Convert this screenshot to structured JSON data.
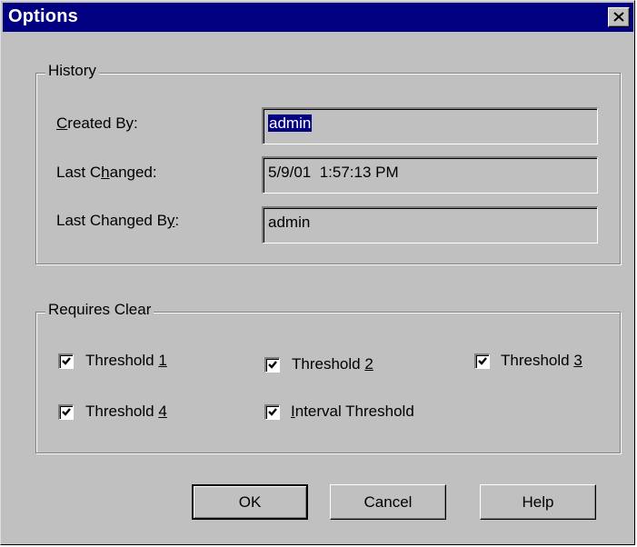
{
  "dialog": {
    "title": "Options",
    "close_glyph": "close-icon"
  },
  "history": {
    "group_label": "History",
    "created_by": {
      "prefix": "",
      "mnemonic": "C",
      "suffix": "reated By:",
      "value": "admin",
      "value_selected": true
    },
    "last_changed": {
      "prefix": "Last C",
      "mnemonic": "h",
      "suffix": "anged:",
      "value": "5/9/01  1:57:13 PM"
    },
    "last_changed_by": {
      "prefix": "Last Changed B",
      "mnemonic": "y",
      "suffix": ":",
      "value": "admin"
    }
  },
  "requires_clear": {
    "group_label": "Requires Clear",
    "items": [
      {
        "prefix": "Threshold ",
        "mnemonic": "1",
        "suffix": "",
        "checked": true
      },
      {
        "prefix": "Threshold ",
        "mnemonic": "2",
        "suffix": "",
        "checked": true
      },
      {
        "prefix": "Threshold ",
        "mnemonic": "3",
        "suffix": "",
        "checked": true
      },
      {
        "prefix": "Threshold ",
        "mnemonic": "4",
        "suffix": "",
        "checked": true
      },
      {
        "prefix": "",
        "mnemonic": "I",
        "suffix": "nterval Threshold",
        "checked": true
      }
    ]
  },
  "buttons": {
    "ok": "OK",
    "cancel": "Cancel",
    "help": "Help"
  },
  "colors": {
    "titlebar": "#000080",
    "face": "#c0c0c0",
    "selection": "#000080"
  }
}
